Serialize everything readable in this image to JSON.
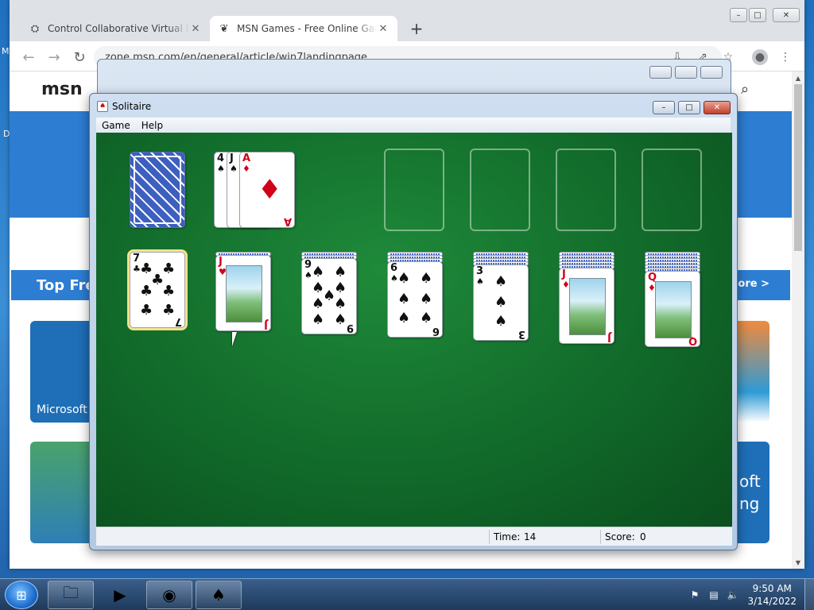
{
  "desktop": {
    "left_label": "M",
    "left_label2": "D"
  },
  "browser": {
    "tabs": [
      {
        "title": "Control Collaborative Virtual Ma",
        "favicon": "vm-icon"
      },
      {
        "title": "MSN Games - Free Online Games",
        "favicon": "msn-butterfly-icon",
        "active": true
      }
    ],
    "new_tab": "+",
    "address": "zone.msn.com/en/general/article/win7landingpage",
    "window_controls": {
      "minimize": "–",
      "maximize": "□",
      "close": "✕"
    }
  },
  "msn": {
    "logo": "msn",
    "top_free": "Top Fre",
    "more": "more >",
    "tile1_label": "Microsoft",
    "tile2_text1": "oft",
    "tile2_text2": "ng"
  },
  "solitaire": {
    "title": "Solitaire",
    "menu": [
      "Game",
      "Help"
    ],
    "status": {
      "time_label": "Time:",
      "time_value": "14",
      "score_label": "Score:",
      "score_value": "0"
    },
    "waste": [
      {
        "rank": "4",
        "suit": "♠",
        "color": "black"
      },
      {
        "rank": "J",
        "suit": "♠",
        "color": "black"
      },
      {
        "rank": "A",
        "suit": "♦",
        "color": "red"
      }
    ],
    "tableau": [
      {
        "hidden": 0,
        "rank": "7",
        "suit": "♣",
        "color": "black",
        "selected": true
      },
      {
        "hidden": 1,
        "rank": "J",
        "suit": "♥",
        "color": "red"
      },
      {
        "hidden": 2,
        "rank": "9",
        "suit": "♠",
        "color": "black"
      },
      {
        "hidden": 3,
        "rank": "6",
        "suit": "♠",
        "color": "black"
      },
      {
        "hidden": 4,
        "rank": "3",
        "suit": "♠",
        "color": "black"
      },
      {
        "hidden": 5,
        "rank": "J",
        "suit": "♦",
        "color": "red"
      },
      {
        "hidden": 6,
        "rank": "Q",
        "suit": "♦",
        "color": "red"
      }
    ]
  },
  "taskbar": {
    "time": "9:50 AM",
    "date": "3/14/2022",
    "apps": [
      "file-explorer-icon",
      "media-player-icon",
      "chrome-icon",
      "solitaire-icon"
    ]
  }
}
